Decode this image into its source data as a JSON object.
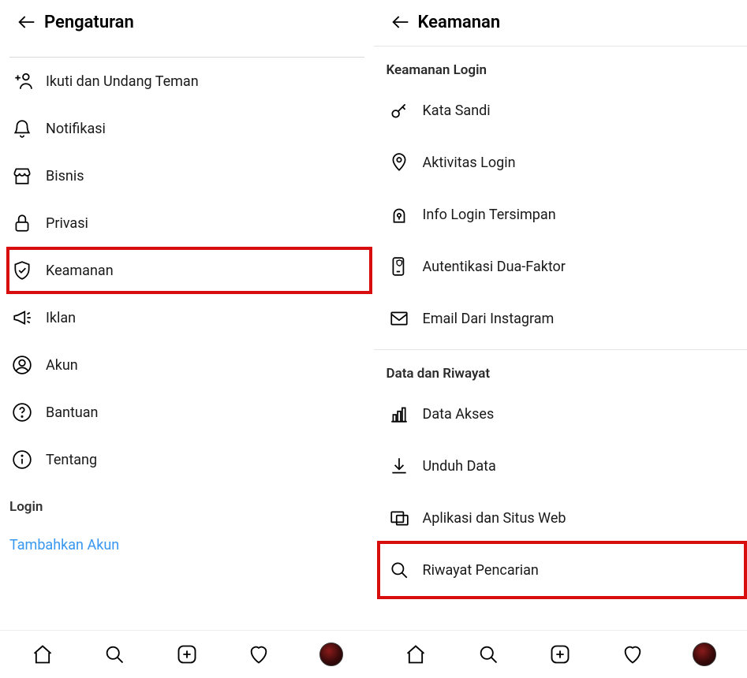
{
  "left": {
    "title": "Pengaturan",
    "items": [
      {
        "icon": "add-user-icon",
        "label": "Ikuti dan Undang Teman"
      },
      {
        "icon": "bell-icon",
        "label": "Notifikasi"
      },
      {
        "icon": "storefront-icon",
        "label": "Bisnis"
      },
      {
        "icon": "lock-icon",
        "label": "Privasi"
      },
      {
        "icon": "shield-check-icon",
        "label": "Keamanan",
        "highlight": true
      },
      {
        "icon": "megaphone-icon",
        "label": "Iklan"
      },
      {
        "icon": "user-circle-icon",
        "label": "Akun"
      },
      {
        "icon": "help-circle-icon",
        "label": "Bantuan"
      },
      {
        "icon": "info-circle-icon",
        "label": "Tentang"
      }
    ],
    "login_section_label": "Login",
    "add_account_label": "Tambahkan Akun"
  },
  "right": {
    "title": "Keamanan",
    "section1_label": "Keamanan Login",
    "section1_items": [
      {
        "icon": "key-icon",
        "label": "Kata Sandi"
      },
      {
        "icon": "pin-icon",
        "label": "Aktivitas Login"
      },
      {
        "icon": "keyhole-icon",
        "label": "Info Login Tersimpan"
      },
      {
        "icon": "phone-shield-icon",
        "label": "Autentikasi Dua-Faktor"
      },
      {
        "icon": "mail-icon",
        "label": "Email Dari Instagram"
      }
    ],
    "section2_label": "Data dan Riwayat",
    "section2_items": [
      {
        "icon": "chart-icon",
        "label": "Data Akses"
      },
      {
        "icon": "download-icon",
        "label": "Unduh Data"
      },
      {
        "icon": "apps-icon",
        "label": "Aplikasi dan Situs Web"
      },
      {
        "icon": "search-icon",
        "label": "Riwayat Pencarian",
        "highlight": true
      }
    ]
  },
  "nav": {
    "items": [
      "home",
      "search",
      "create",
      "activity",
      "profile"
    ]
  }
}
